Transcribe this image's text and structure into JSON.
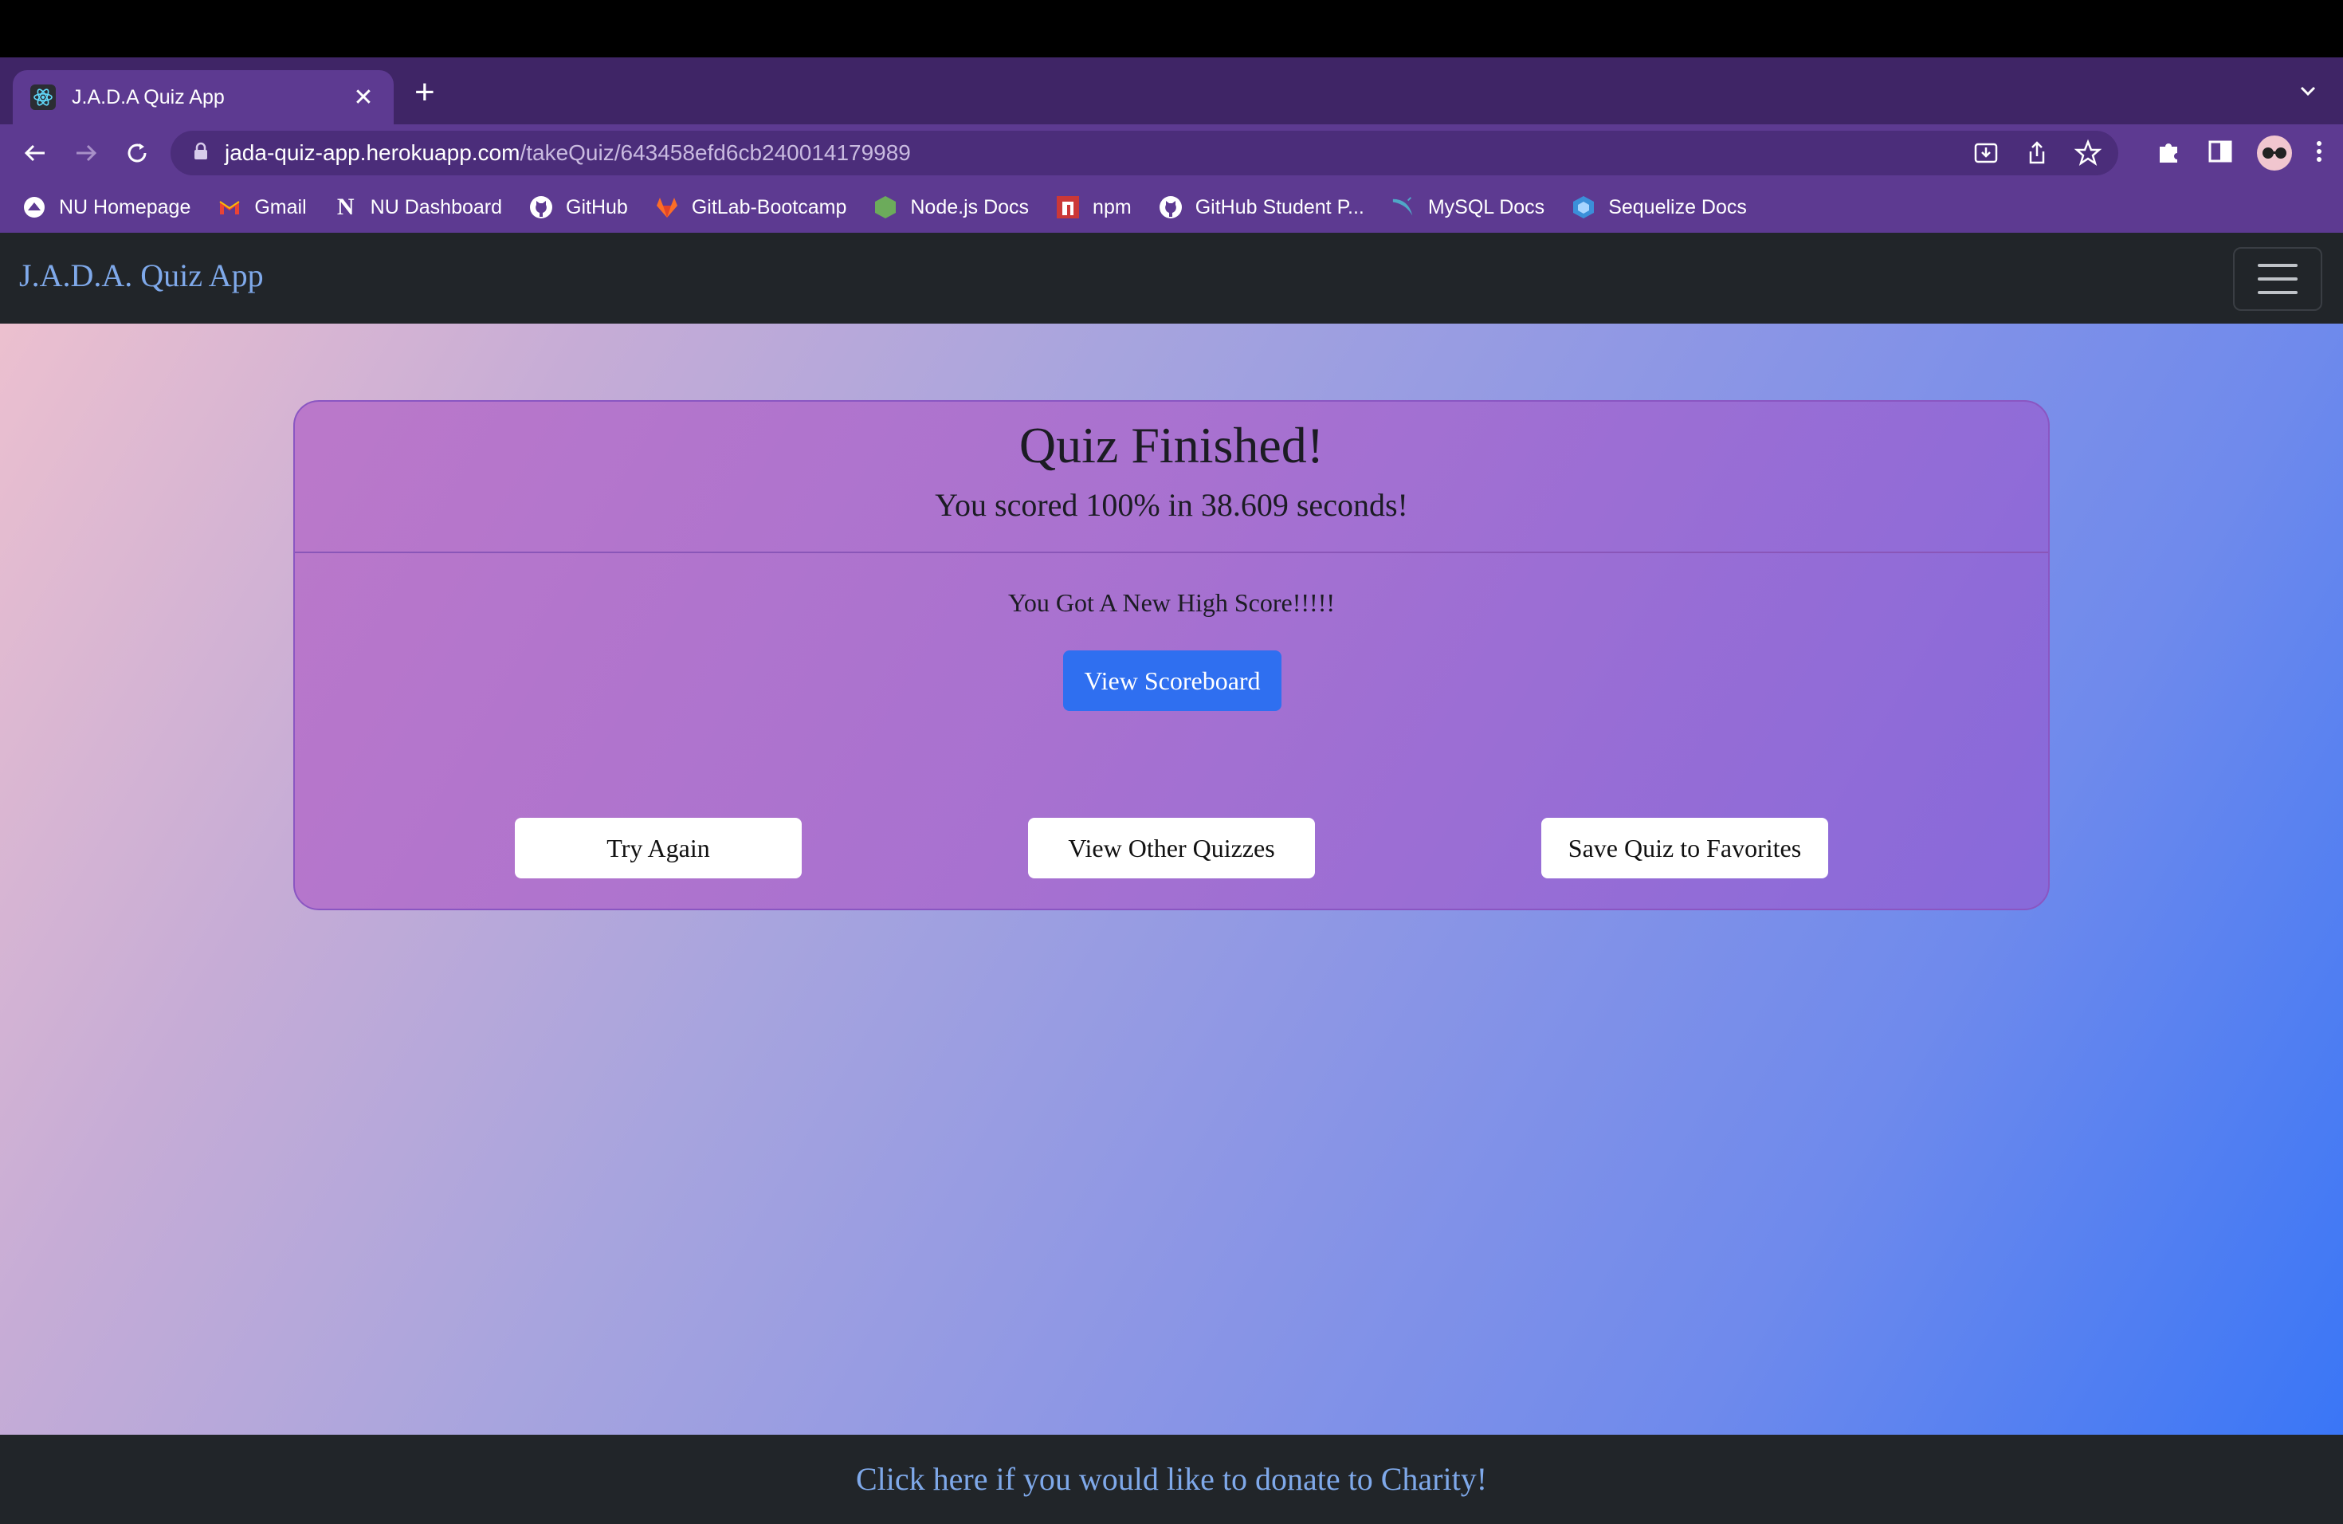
{
  "browser": {
    "tab": {
      "title": "J.A.D.A Quiz App",
      "favicon": "react-atom-icon"
    },
    "address": {
      "host": "jada-quiz-app.herokuapp.com",
      "path": "/takeQuiz/643458efd6cb240014179989"
    },
    "bookmarks": [
      {
        "label": "NU Homepage",
        "icon": "nu-icon"
      },
      {
        "label": "Gmail",
        "icon": "gmail-icon"
      },
      {
        "label": "NU Dashboard",
        "icon": "notion-icon"
      },
      {
        "label": "GitHub",
        "icon": "github-icon"
      },
      {
        "label": "GitLab-Bootcamp",
        "icon": "gitlab-icon"
      },
      {
        "label": "Node.js Docs",
        "icon": "nodejs-icon"
      },
      {
        "label": "npm",
        "icon": "npm-icon"
      },
      {
        "label": "GitHub Student P...",
        "icon": "github-icon"
      },
      {
        "label": "MySQL Docs",
        "icon": "mysql-icon"
      },
      {
        "label": "Sequelize Docs",
        "icon": "sequelize-icon"
      }
    ]
  },
  "navbar": {
    "brand": "J.A.D.A. Quiz App"
  },
  "result": {
    "title": "Quiz Finished!",
    "summary": "You scored 100% in 38.609 seconds!",
    "high_score_message": "You Got A New High Score!!!!!",
    "scoreboard_button": "View Scoreboard",
    "try_again_button": "Try Again",
    "other_quizzes_button": "View Other Quizzes",
    "favorite_button": "Save Quiz to Favorites"
  },
  "footer": {
    "donate_link": "Click here if you would like to donate to Charity!"
  },
  "colors": {
    "tab_strip": "#3f2566",
    "toolbar": "#5d3a91",
    "navbar": "#212529",
    "brand": "#7fa9ea",
    "primary_button": "#2f6ff0"
  }
}
